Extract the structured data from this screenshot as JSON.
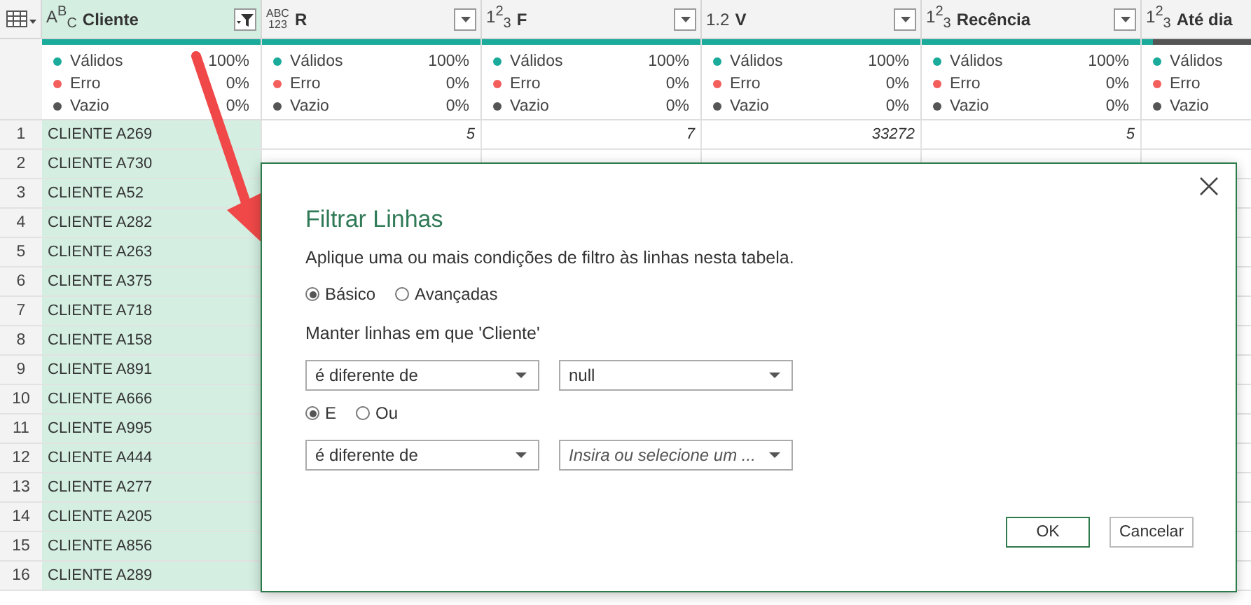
{
  "table": {
    "columns": [
      {
        "name": "Cliente",
        "type_label": "A$^{B}$$_{C}$",
        "selected": true,
        "filtered": true,
        "level": 1,
        "stats": [
          {
            "label": "Válidos",
            "value": "100%",
            "color": "#1aab9b"
          },
          {
            "label": "Erro",
            "value": "0%",
            "color": "#f25f5c"
          },
          {
            "label": "Vazio",
            "value": "0%",
            "color": "#555555"
          }
        ]
      },
      {
        "name": "R",
        "type_label": "ABC\n123",
        "selected": false,
        "filtered": false,
        "level": 1,
        "stats": [
          {
            "label": "Válidos",
            "value": "100%",
            "color": "#1aab9b"
          },
          {
            "label": "Erro",
            "value": "0%",
            "color": "#f25f5c"
          },
          {
            "label": "Vazio",
            "value": "0%",
            "color": "#555555"
          }
        ]
      },
      {
        "name": "F",
        "type_label": "1$^{2}$$_{3}$",
        "selected": false,
        "filtered": false,
        "level": 1,
        "stats": [
          {
            "label": "Válidos",
            "value": "100%",
            "color": "#1aab9b"
          },
          {
            "label": "Erro",
            "value": "0%",
            "color": "#f25f5c"
          },
          {
            "label": "Vazio",
            "value": "0%",
            "color": "#555555"
          }
        ]
      },
      {
        "name": "V",
        "type_label": "1.2",
        "selected": false,
        "filtered": false,
        "level": 1,
        "stats": [
          {
            "label": "Válidos",
            "value": "100%",
            "color": "#1aab9b"
          },
          {
            "label": "Erro",
            "value": "0%",
            "color": "#f25f5c"
          },
          {
            "label": "Vazio",
            "value": "0%",
            "color": "#555555"
          }
        ]
      },
      {
        "name": "Recência",
        "type_label": "1$^{2}$$_{3}$",
        "selected": false,
        "filtered": false,
        "level": 1,
        "stats": [
          {
            "label": "Válidos",
            "value": "100%",
            "color": "#1aab9b"
          },
          {
            "label": "Erro",
            "value": "0%",
            "color": "#f25f5c"
          },
          {
            "label": "Vazio",
            "value": "0%",
            "color": "#555555"
          }
        ]
      },
      {
        "name": "Até dia",
        "type_label": "1$^{2}$$_{3}$",
        "selected": false,
        "level": 0.05,
        "stats": [
          {
            "label": "Válidos",
            "color": "#1aab9b"
          },
          {
            "label": "Erro",
            "color": "#f25f5c"
          },
          {
            "label": "Vazio",
            "color": "#555555"
          }
        ]
      }
    ],
    "rows": [
      {
        "index": "1",
        "cells": [
          "CLIENTE A269",
          "5",
          "7",
          "33272",
          "5"
        ]
      },
      {
        "index": "2",
        "cells": [
          "CLIENTE A730"
        ]
      },
      {
        "index": "3",
        "cells": [
          "CLIENTE A52"
        ]
      },
      {
        "index": "4",
        "cells": [
          "CLIENTE A282"
        ]
      },
      {
        "index": "5",
        "cells": [
          "CLIENTE A263"
        ]
      },
      {
        "index": "6",
        "cells": [
          "CLIENTE A375"
        ]
      },
      {
        "index": "7",
        "cells": [
          "CLIENTE A718"
        ]
      },
      {
        "index": "8",
        "cells": [
          "CLIENTE A158"
        ]
      },
      {
        "index": "9",
        "cells": [
          "CLIENTE A891"
        ]
      },
      {
        "index": "10",
        "cells": [
          "CLIENTE A666"
        ]
      },
      {
        "index": "11",
        "cells": [
          "CLIENTE A995"
        ]
      },
      {
        "index": "12",
        "cells": [
          "CLIENTE A444"
        ]
      },
      {
        "index": "13",
        "cells": [
          "CLIENTE A277"
        ]
      },
      {
        "index": "14",
        "cells": [
          "CLIENTE A205"
        ]
      },
      {
        "index": "15",
        "cells": [
          "CLIENTE A856"
        ]
      },
      {
        "index": "16",
        "cells": [
          "CLIENTE A289"
        ]
      }
    ]
  },
  "dialog": {
    "title": "Filtrar Linhas",
    "description": "Aplique uma ou mais condições de filtro às linhas nesta tabela.",
    "modes": [
      {
        "label": "Básico",
        "selected": true
      },
      {
        "label": "Avançadas",
        "selected": false
      }
    ],
    "condition_label": "Manter linhas em que 'Cliente'",
    "conditions": [
      {
        "operator": "é diferente de",
        "value": "null"
      },
      {
        "operator": "é diferente de",
        "placeholder": "Insira ou selecione um ..."
      }
    ],
    "conjunctions": [
      {
        "label": "E",
        "selected": true
      },
      {
        "label": "Ou",
        "selected": false
      }
    ],
    "buttons": [
      {
        "label": "OK",
        "kind": "primary"
      },
      {
        "label": "Cancelar",
        "kind": "secondary"
      }
    ]
  }
}
